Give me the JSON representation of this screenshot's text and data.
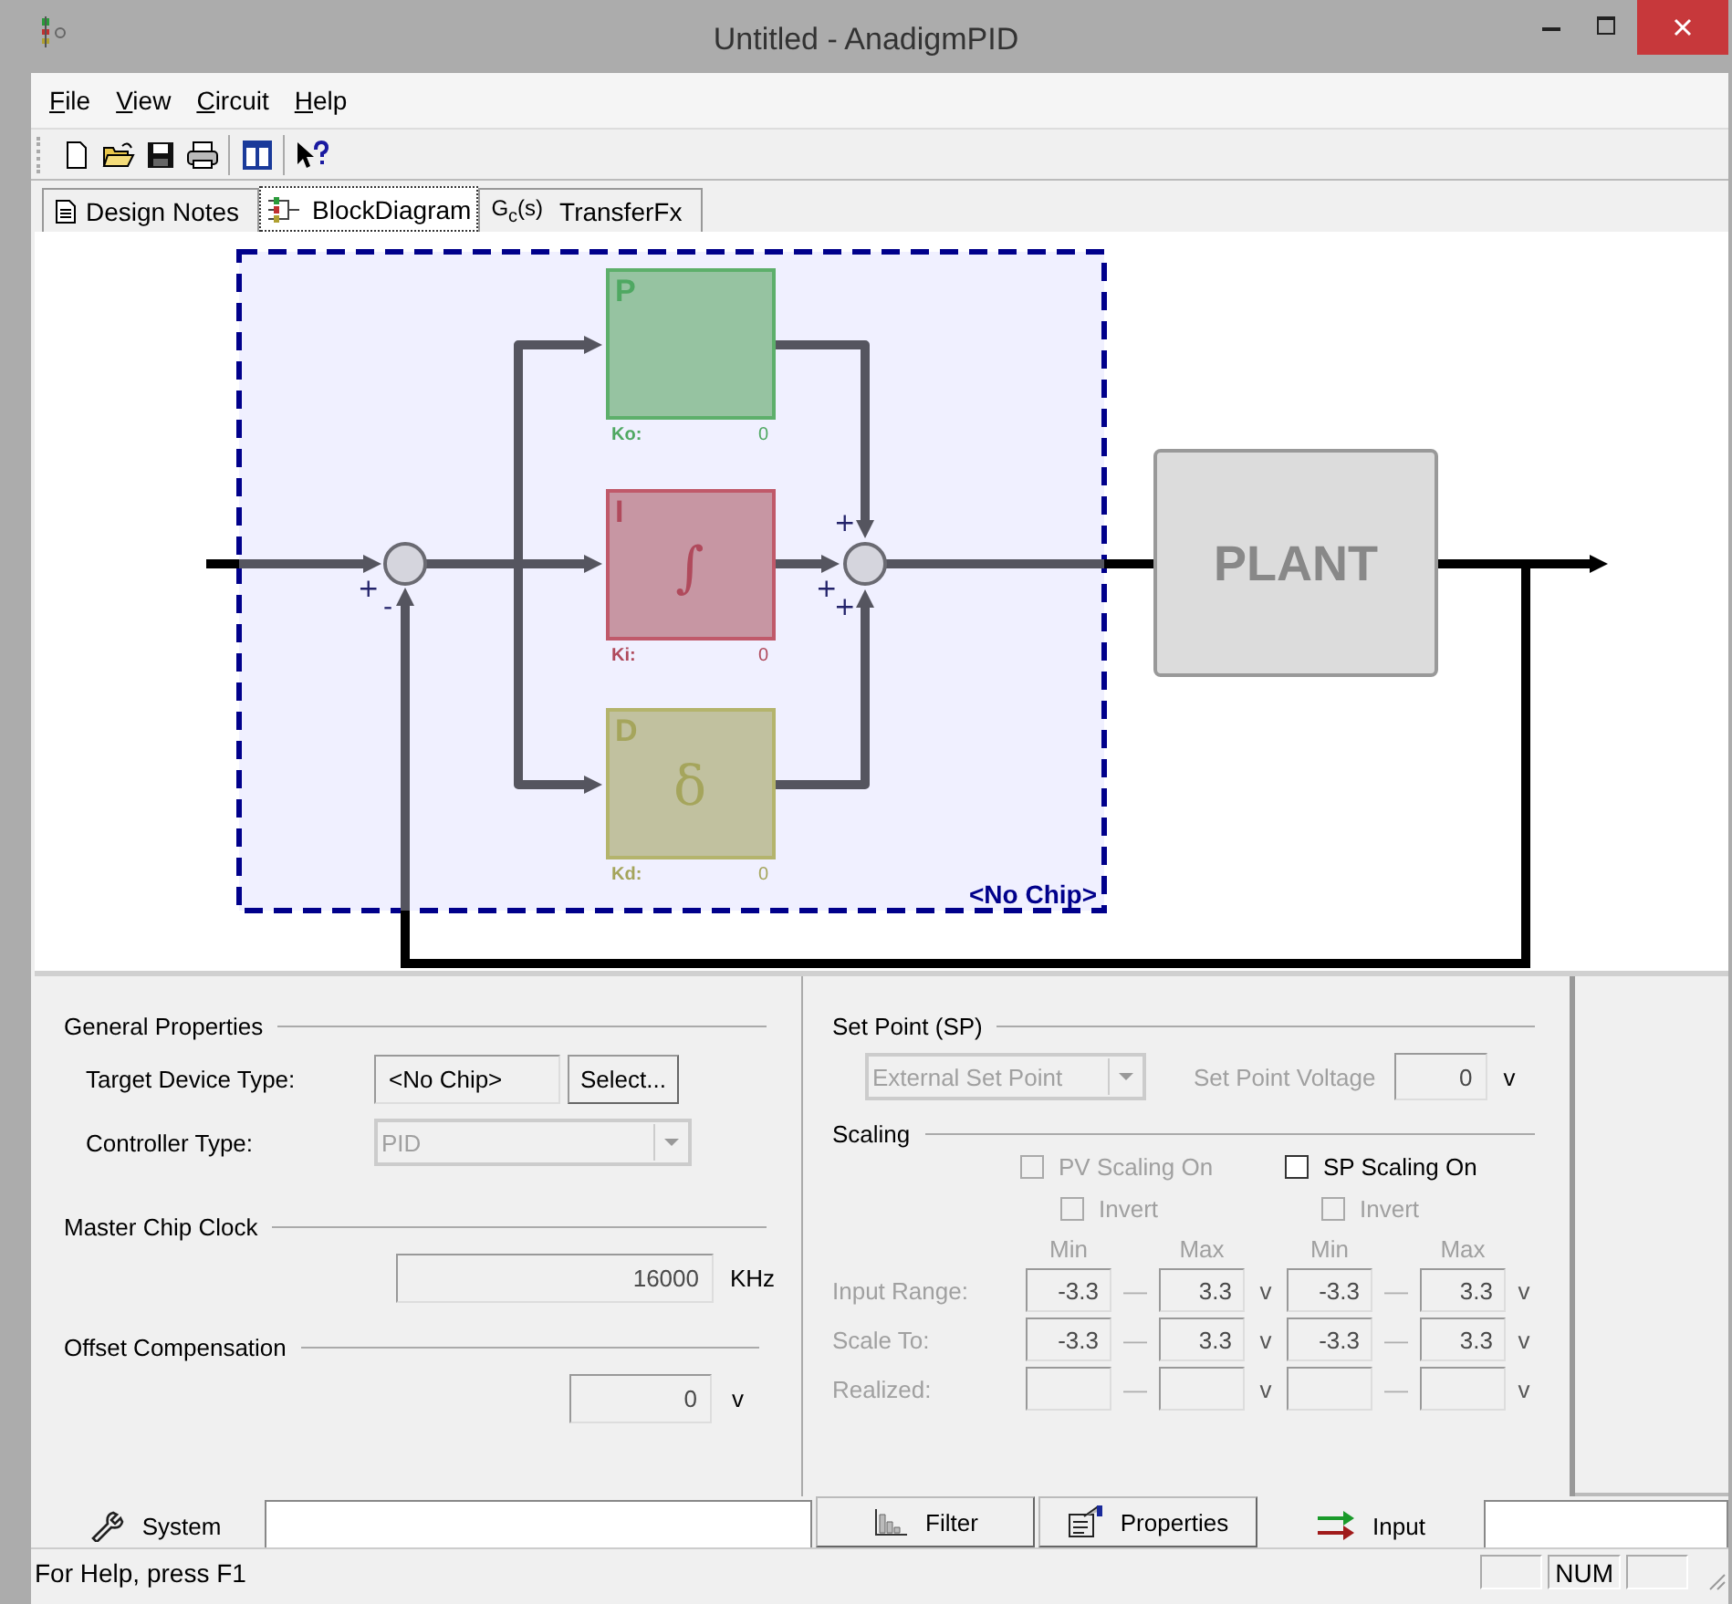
{
  "window": {
    "title": "Untitled - AnadigmPID"
  },
  "menu": [
    {
      "label": "File"
    },
    {
      "label": "View"
    },
    {
      "label": "Circuit"
    },
    {
      "label": "Help"
    }
  ],
  "tabs": [
    {
      "kind": "notes",
      "label": "Design Notes",
      "selected": false
    },
    {
      "kind": "diagram",
      "label": "BlockDiagram",
      "selected": true
    },
    {
      "kind": "transfer",
      "icon_text": "G$_{c}$(s)",
      "label": "TransferFx",
      "selected": false
    }
  ],
  "diagram": {
    "chip_label": "<No Chip>",
    "plant_label": "PLANT",
    "sum1_signs": [
      "+",
      "-"
    ],
    "sum2_signs": [
      "+",
      "+",
      "+"
    ],
    "blocks": [
      {
        "kind": "p",
        "letter": "P",
        "gain_label": "Ko:",
        "gain_value": "0"
      },
      {
        "kind": "i",
        "letter": "I",
        "symbol": "∫",
        "gain_label": "Ki:",
        "gain_value": "0"
      },
      {
        "kind": "d",
        "letter": "D",
        "symbol": "δ",
        "gain_label": "Kd:",
        "gain_value": "0"
      }
    ]
  },
  "general_properties": {
    "title": "General Properties",
    "target_device": {
      "label": "Target Device Type:",
      "value": "<No Chip>",
      "button": "Select..."
    },
    "controller_type": {
      "label": "Controller Type:",
      "value": "PID",
      "disabled": true
    }
  },
  "master_clock": {
    "title": "Master Chip Clock",
    "value": "16000",
    "unit": "KHz"
  },
  "offset": {
    "title": "Offset Compensation",
    "value": "0",
    "unit": "v"
  },
  "set_point": {
    "title": "Set Point (SP)",
    "dropdown": {
      "value": "External Set Point",
      "disabled": true
    },
    "voltage": {
      "label": "Set Point Voltage",
      "value": "0",
      "unit": "v",
      "disabled": true
    }
  },
  "scaling": {
    "title": "Scaling",
    "toggles": [
      {
        "label": "PV Scaling On",
        "checked": false,
        "disabled": true
      },
      {
        "label": "SP Scaling On",
        "checked": false,
        "disabled": false
      }
    ],
    "inverts": [
      {
        "label": "Invert",
        "checked": false,
        "disabled": true
      },
      {
        "label": "Invert",
        "checked": false,
        "disabled": true
      }
    ],
    "headers": [
      "Min",
      "Max",
      "Min",
      "Max"
    ],
    "rows": [
      {
        "label": "Input Range:",
        "disabled": true,
        "pairs": [
          {
            "min": "-3.3",
            "dash": "—",
            "max": "3.3",
            "unit": "v"
          },
          {
            "min": "-3.3",
            "dash": "—",
            "max": "3.3",
            "unit": "v"
          }
        ]
      },
      {
        "label": "Scale To:",
        "disabled": true,
        "pairs": [
          {
            "min": "-3.3",
            "dash": "—",
            "max": "3.3",
            "unit": "v"
          },
          {
            "min": "-3.3",
            "dash": "—",
            "max": "3.3",
            "unit": "v"
          }
        ]
      },
      {
        "label": "Realized:",
        "disabled": true,
        "pairs": [
          {
            "dash": "—",
            "unit": "v"
          },
          {
            "dash": "—",
            "unit": "v"
          }
        ]
      }
    ]
  },
  "left_tabs": [
    {
      "kind": "system",
      "label": "System",
      "selected": true
    }
  ],
  "right_tabs": [
    {
      "kind": "filter",
      "label": "Filter",
      "selected": false
    },
    {
      "kind": "properties",
      "label": "Properties",
      "selected": false
    },
    {
      "kind": "input",
      "label": "Input",
      "selected": true
    }
  ],
  "status_bar": {
    "text": "For Help, press F1",
    "indicators": [
      "NUM"
    ]
  }
}
